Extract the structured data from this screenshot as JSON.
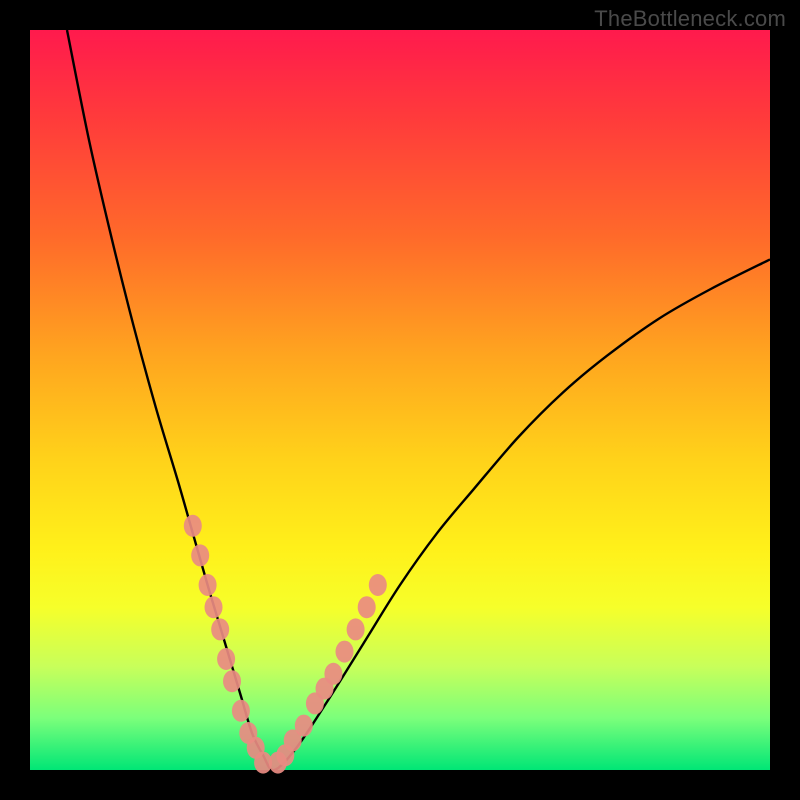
{
  "watermark": "TheBottleneck.com",
  "colors": {
    "frame": "#000000",
    "gradient_top": "#ff1a4d",
    "gradient_bottom": "#00e676",
    "curve": "#000000",
    "markers": "#e98b82"
  },
  "chart_data": {
    "type": "line",
    "title": "",
    "xlabel": "",
    "ylabel": "",
    "xlim": [
      0,
      100
    ],
    "ylim": [
      0,
      100
    ],
    "x": [
      5,
      8,
      11,
      14,
      17,
      20,
      22,
      24,
      25.5,
      27,
      28.5,
      30,
      31.5,
      33,
      36,
      40,
      45,
      50,
      55,
      60,
      66,
      72,
      78,
      85,
      92,
      100
    ],
    "values": [
      100,
      85,
      72,
      60,
      49,
      39,
      32,
      25,
      20,
      15,
      10,
      5,
      2,
      0,
      3,
      9,
      17,
      25,
      32,
      38,
      45,
      51,
      56,
      61,
      65,
      69
    ],
    "series": [
      {
        "name": "markers-left",
        "x": [
          22.0,
          23.0,
          24.0,
          24.8,
          25.7,
          26.5,
          27.3,
          28.5,
          29.5,
          30.5,
          31.5
        ],
        "values": [
          33,
          29,
          25,
          22,
          19,
          15,
          12,
          8,
          5,
          3,
          1
        ]
      },
      {
        "name": "markers-right",
        "x": [
          33.5,
          34.5,
          35.5,
          37.0,
          38.5,
          39.8,
          41.0,
          42.5,
          44.0,
          45.5,
          47.0
        ],
        "values": [
          1,
          2,
          4,
          6,
          9,
          11,
          13,
          16,
          19,
          22,
          25
        ]
      }
    ]
  }
}
